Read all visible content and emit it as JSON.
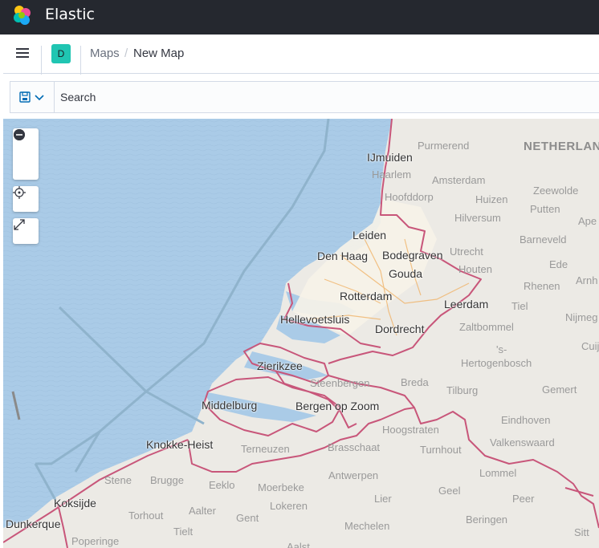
{
  "header": {
    "brand": "Elastic"
  },
  "nav": {
    "space_initial": "D",
    "breadcrumb_root": "Maps",
    "breadcrumb_separator": "/",
    "breadcrumb_current": "New Map"
  },
  "query": {
    "search_placeholder": "Search"
  },
  "map": {
    "labels": {
      "country": "NETHERLAN",
      "purmerend": "Purmerend",
      "ijmuiden": "IJmuiden",
      "haarlem": "Haarlem",
      "amsterdam": "Amsterdam",
      "zeewolde": "Zeewolde",
      "hoofddorp": "Hoofddorp",
      "huizen": "Huizen",
      "putten": "Putten",
      "hilversum": "Hilversum",
      "ape": "Ape",
      "barneveld": "Barneveld",
      "leiden": "Leiden",
      "utrecht": "Utrecht",
      "den_haag": "Den Haag",
      "bodegraven": "Bodegraven",
      "houten": "Houten",
      "ede": "Ede",
      "gouda": "Gouda",
      "arnh": "Arnh",
      "rhenen": "Rhenen",
      "rotterdam": "Rotterdam",
      "leerdam": "Leerdam",
      "tiel": "Tiel",
      "hellevoetsluis": "Hellevoetsluis",
      "nijmeg": "Nijmeg",
      "dordrecht": "Dordrecht",
      "zaltbommel": "Zaltbommel",
      "s": "'s-",
      "cuij": "Cuij",
      "hertogenbosch": "Hertogenbosch",
      "zierikzee": "Zierikzee",
      "steenbergen": "Steenbergen",
      "breda": "Breda",
      "tilburg": "Tilburg",
      "gemert": "Gemert",
      "middelburg": "Middelburg",
      "bergen_op_zoom": "Bergen op Zoom",
      "eindhoven": "Eindhoven",
      "hoogstraten": "Hoogstraten",
      "knokke_heist": "Knokke-Heist",
      "terneuzen": "Terneuzen",
      "brasschaat": "Brasschaat",
      "turnhout": "Turnhout",
      "valkenswaard": "Valkenswaard",
      "antwerpen": "Antwerpen",
      "lommel": "Lommel",
      "stene": "Stene",
      "brugge": "Brugge",
      "eeklo": "Eeklo",
      "moerbeke": "Moerbeke",
      "lier": "Lier",
      "geel": "Geel",
      "peer": "Peer",
      "koksijde": "Koksijde",
      "lokeren": "Lokeren",
      "torhout": "Torhout",
      "aalter": "Aalter",
      "gent": "Gent",
      "beringen": "Beringen",
      "dunkerque": "Dunkerque",
      "tielt": "Tielt",
      "mechelen": "Mechelen",
      "sitt": "Sitt",
      "poperinge": "Poperinge",
      "aalst": "Aalst"
    }
  },
  "colors": {
    "sea": "#aacbe7",
    "land": "#eceae5",
    "border": "#c8567a",
    "header_bg": "#25282f",
    "accent": "#20c5b2"
  }
}
